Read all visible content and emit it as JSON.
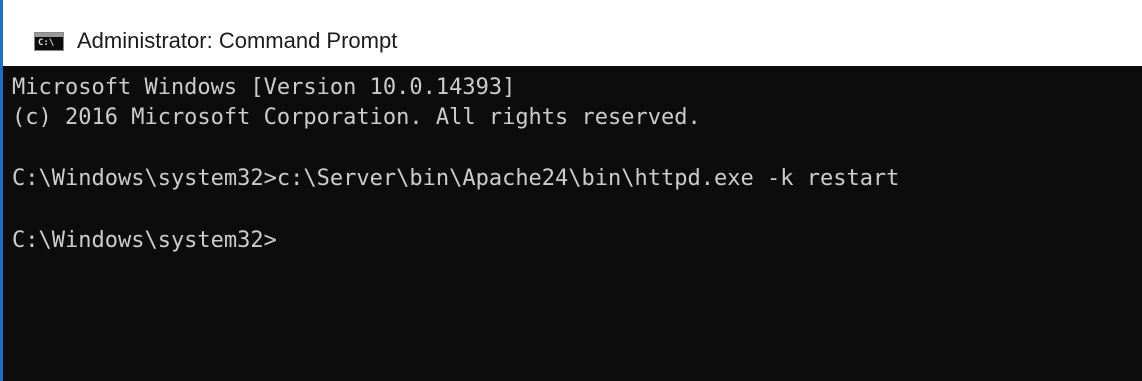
{
  "window": {
    "title": "Administrator: Command Prompt",
    "icon": "cmd-console-icon",
    "icon_label": "C:\\"
  },
  "console": {
    "lines": [
      "Microsoft Windows [Version 10.0.14393]",
      "(c) 2016 Microsoft Corporation. All rights reserved.",
      "C:\\Windows\\system32>c:\\Server\\bin\\Apache24\\bin\\httpd.exe -k restart",
      "C:\\Windows\\system32>"
    ]
  },
  "colors": {
    "console_background": "#0c0c0c",
    "console_text": "#cccccc",
    "titlebar_background": "#ffffff",
    "title_text": "#1b1b1b",
    "accent_edge": "#1a6fc9"
  }
}
